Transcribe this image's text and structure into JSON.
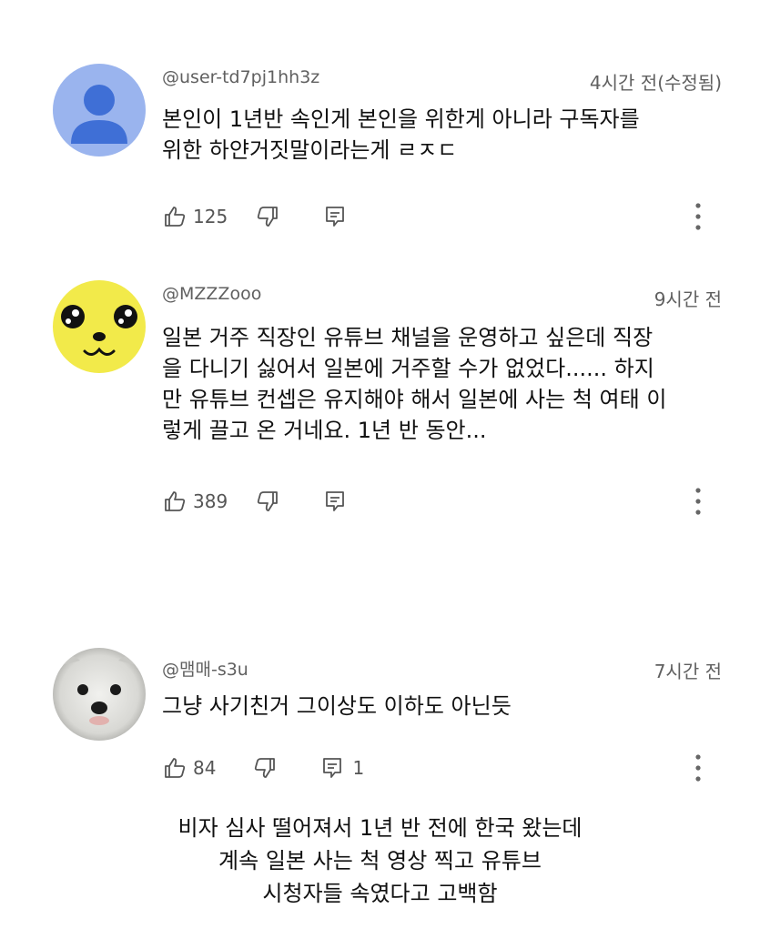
{
  "comments": [
    {
      "author": "@user-td7pj1hh3z",
      "time": "4시간 전(수정됨)",
      "lines": [
        "본인이 1년반 속인게 본인을 위한게 아니라 구독자를",
        "위한 하얀거짓말이라는게 ㄹㅈㄷ"
      ],
      "likes": "125",
      "avatar": "default-person-icon"
    },
    {
      "author": "@MZZZooo",
      "time": "9시간 전",
      "lines": [
        "일본 거주 직장인 유튜브 채널을 운영하고 싶은데 직장",
        "을 다니기 싫어서 일본에 거주할 수가 없었다...... 하지",
        "만 유튜브 컨셉은 유지해야 해서 일본에 사는 척 여태 이",
        "렇게 끌고 온 거네요. 1년 반 동안..."
      ],
      "likes": "389",
      "avatar": "yellow-cartoon-face"
    },
    {
      "author": "@맴매-s3u",
      "time": "7시간 전",
      "lines": [
        "그냥 사기친거 그이상도 이하도 아닌듯"
      ],
      "likes": "84",
      "replies": "1",
      "avatar": "white-dog-photo"
    }
  ],
  "caption": {
    "lines": [
      "비자 심사 떨어져서 1년 반 전에 한국 왔는데",
      "계속 일본 사는 척 영상 찍고 유튜브",
      "시청자들 속였다고 고백함"
    ]
  }
}
